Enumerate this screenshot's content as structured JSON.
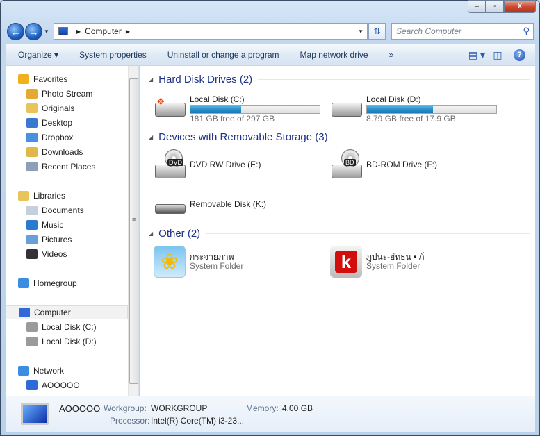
{
  "window": {
    "minimize": "–",
    "maximize": "▫",
    "close": "X"
  },
  "address": {
    "root_label": "Computer",
    "search_placeholder": "Search Computer"
  },
  "toolbar": {
    "items": [
      "Organize ▾",
      "System properties",
      "Uninstall or change a program",
      "Map network drive",
      "»"
    ]
  },
  "sidebar": {
    "items": [
      {
        "label": "Favorites",
        "color": "#f0b21c"
      },
      {
        "label": "Photo Stream",
        "color": "#e6a832"
      },
      {
        "label": "Originals",
        "color": "#e8c55a"
      },
      {
        "label": "Desktop",
        "color": "#3b78d0"
      },
      {
        "label": "Dropbox",
        "color": "#4a8fe0"
      },
      {
        "label": "Downloads",
        "color": "#e0b84a"
      },
      {
        "label": "Recent Places",
        "color": "#8ca0b8"
      },
      {
        "label": "Libraries",
        "color": "#e8c55a"
      },
      {
        "label": "Documents",
        "color": "#c5d0de"
      },
      {
        "label": "Music",
        "color": "#2a7ad0"
      },
      {
        "label": "Pictures",
        "color": "#6aa0d8"
      },
      {
        "label": "Videos",
        "color": "#333"
      },
      {
        "label": "Homegroup",
        "color": "#3a8de0"
      },
      {
        "label": "Computer",
        "color": "#2f6ad8"
      },
      {
        "label": "Local Disk (C:)",
        "color": "#9a9a9a"
      },
      {
        "label": "Local Disk (D:)",
        "color": "#9a9a9a"
      },
      {
        "label": "Network",
        "color": "#3a8de0"
      },
      {
        "label": "AOOOOO",
        "color": "#2f6ad8"
      }
    ]
  },
  "groups": [
    {
      "title": "Hard Disk Drives (2)"
    },
    {
      "title": "Devices with Removable Storage (3)"
    },
    {
      "title": "Other (2)"
    }
  ],
  "drives": [
    {
      "name": "Local Disk (C:)",
      "free": "181 GB free of 297 GB",
      "used_percent": 39
    },
    {
      "name": "Local Disk (D:)",
      "free": "8.79 GB free of 17.9 GB",
      "used_percent": 51
    }
  ],
  "removable": [
    {
      "name": "DVD RW Drive (E:)",
      "badge": "DVD"
    },
    {
      "name": "BD-ROM Drive (F:)",
      "badge": "BD"
    },
    {
      "name": "Removable Disk (K:)"
    }
  ],
  "other": [
    {
      "name": "กระจายภาพ",
      "type": "System Folder"
    },
    {
      "name": "ภูปนะ-ย่ทธน • ภ์",
      "type": "System Folder"
    }
  ],
  "details": {
    "name": "AOOOOO",
    "workgroup_label": "Workgroup:",
    "workgroup": "WORKGROUP",
    "memory_label": "Memory:",
    "memory": "4.00 GB",
    "processor_label": "Processor:",
    "processor": "Intel(R) Core(TM) i3-23..."
  }
}
